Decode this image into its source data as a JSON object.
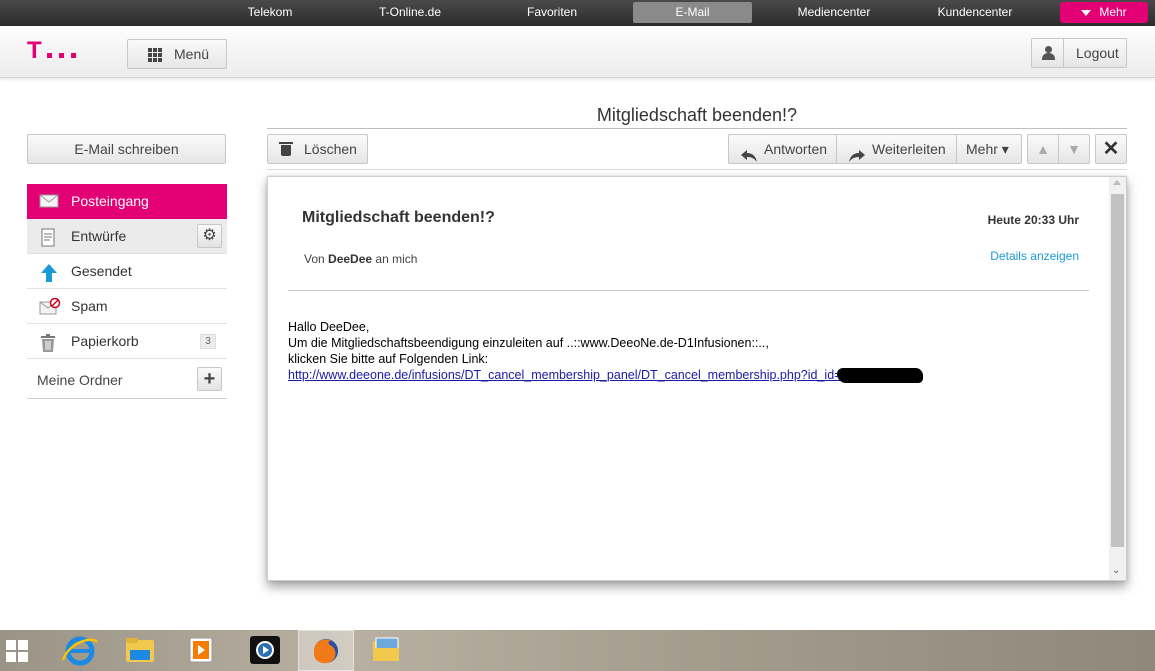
{
  "topnav": {
    "items": [
      "Telekom",
      "T-Online.de",
      "Favoriten",
      "E-Mail",
      "Mediencenter",
      "Kundencenter"
    ],
    "mehr_label": "Mehr"
  },
  "header": {
    "logo_letter": "T",
    "menu_label": "Menü",
    "logout_label": "Logout"
  },
  "sidebar": {
    "compose_label": "E-Mail schreiben",
    "folders": [
      {
        "label": "Posteingang",
        "icon": "envelope-icon"
      },
      {
        "label": "Entwürfe",
        "icon": "draft-icon"
      },
      {
        "label": "Gesendet",
        "icon": "up-arrow-icon"
      },
      {
        "label": "Spam",
        "icon": "spam-icon"
      },
      {
        "label": "Papierkorb",
        "icon": "trash-icon",
        "count": "3"
      }
    ],
    "my_folders_label": "Meine Ordner"
  },
  "mail": {
    "title": "Mitgliedschaft beenden!?",
    "subject": "Mitgliedschaft beenden!?",
    "date": "Heute 20:33 Uhr",
    "from_prefix": "Von",
    "from_name": "DeeDee",
    "from_suffix": "an mich",
    "details_label": "Details anzeigen",
    "body_lines": [
      "Hallo DeeDee,",
      "Um die Mitgliedschaftsbeendigung einzuleiten auf ..::www.DeeoNe.de-D1Infusionen::..,",
      "klicken Sie bitte auf Folgenden Link:"
    ],
    "link": "http://www.deeone.de/infusions/DT_cancel_membership_panel/DT_cancel_membership.php?id_id="
  },
  "toolbar": {
    "delete_label": "Löschen",
    "reply_label": "Antworten",
    "forward_label": "Weiterleiten",
    "more_label": "Mehr ▾",
    "close_glyph": "✕",
    "up_glyph": "▲",
    "down_glyph": "▼"
  },
  "colors": {
    "brand": "#e20074",
    "link": "#1a9bd7"
  },
  "taskbar": {
    "icons": [
      "windows-start-icon",
      "internet-explorer-icon",
      "file-explorer-icon",
      "media-player-icon",
      "media-center-icon",
      "firefox-icon",
      "folder-app-icon"
    ]
  }
}
